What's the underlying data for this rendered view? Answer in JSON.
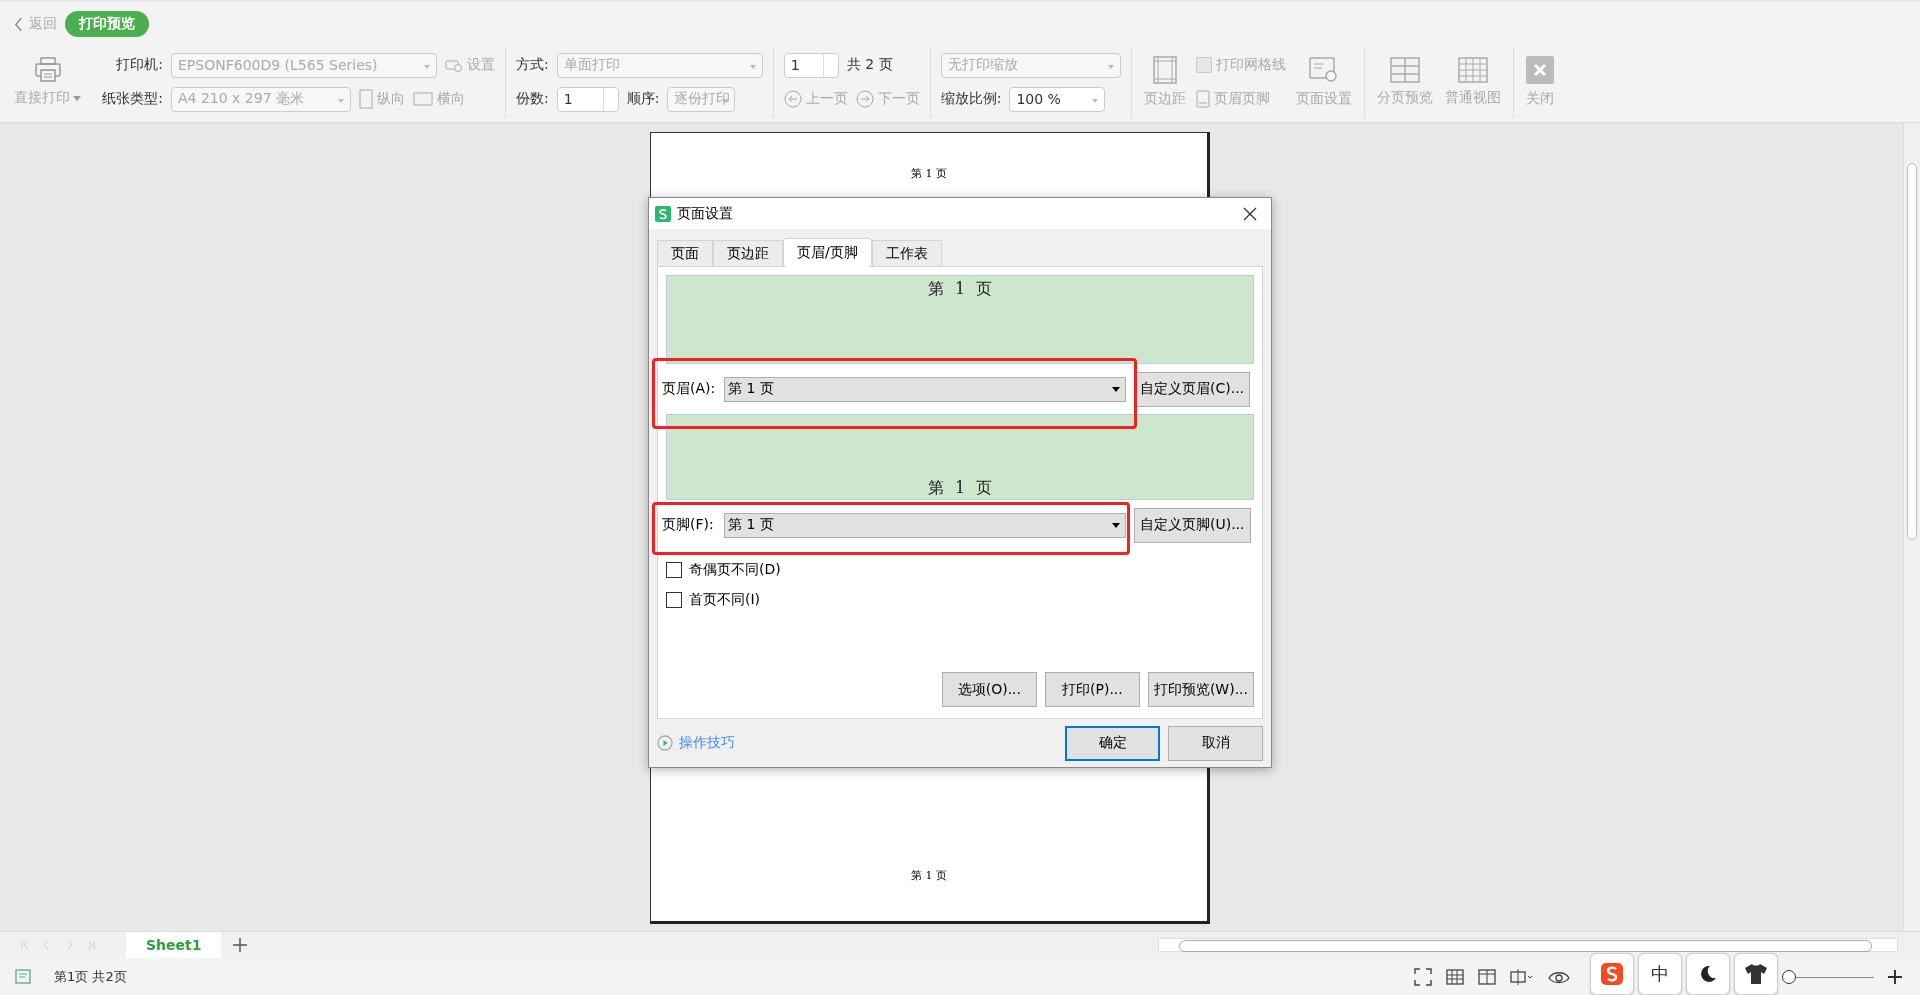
{
  "nav": {
    "back": "返回",
    "mode": "打印预览"
  },
  "toolbar": {
    "direct_print": "直接打印",
    "printer": {
      "label": "打印机:",
      "value": "EPSONF600D9 (L565 Series)"
    },
    "settings": "设置",
    "paper": {
      "label": "纸张类型:",
      "value": "A4 210 x 297 毫米"
    },
    "portrait": "纵向",
    "landscape": "横向",
    "method": {
      "label": "方式:",
      "value": "单面打印"
    },
    "copies": {
      "label": "份数:",
      "value": "1"
    },
    "order": {
      "label": "顺序:",
      "value": "逐份打印"
    },
    "page": {
      "value": "1",
      "total": "共 2 页",
      "prev": "上一页",
      "next": "下一页"
    },
    "scaling": "无打印缩放",
    "zoom": {
      "label": "缩放比例:",
      "value": "100 %"
    },
    "margins": "页边距",
    "gridlines": {
      "label": "打印网格线",
      "checked": false
    },
    "header_footer": "页眉页脚",
    "page_setup": "页面设置",
    "views": [
      {
        "kind": "page_break",
        "label": "分页预览"
      },
      {
        "kind": "normal",
        "label": "普通视图"
      }
    ],
    "close": "关闭"
  },
  "preview_page": {
    "header": "第 1 页",
    "footer": "第 1 页"
  },
  "dialog": {
    "title": "页面设置",
    "tabs": [
      {
        "label": "页面",
        "selected": false
      },
      {
        "label": "页边距",
        "selected": false
      },
      {
        "label": "页眉/页脚",
        "selected": true
      },
      {
        "label": "工作表",
        "selected": false
      }
    ],
    "header_preview": "第 1 页",
    "header_label": "页眉(A):",
    "header_value": "第 1 页",
    "custom_header": "自定义页眉(C)...",
    "footer_preview": "第 1 页",
    "footer_label": "页脚(F):",
    "footer_value": "第 1 页",
    "custom_footer": "自定义页脚(U)...",
    "checkboxes": [
      {
        "label": "奇偶页不同(D)",
        "checked": false
      },
      {
        "label": "首页不同(I)",
        "checked": false
      }
    ],
    "buttons": [
      "选项(O)...",
      "打印(P)...",
      "打印预览(W)..."
    ],
    "tips": "操作技巧",
    "ok": "确定",
    "cancel": "取消"
  },
  "sheet_tabs": [
    {
      "label": "Sheet1",
      "selected": true
    }
  ],
  "status": "第1页 共2页",
  "zoom_slider": {
    "level": 0.05
  },
  "ime": {
    "mode": "中"
  }
}
